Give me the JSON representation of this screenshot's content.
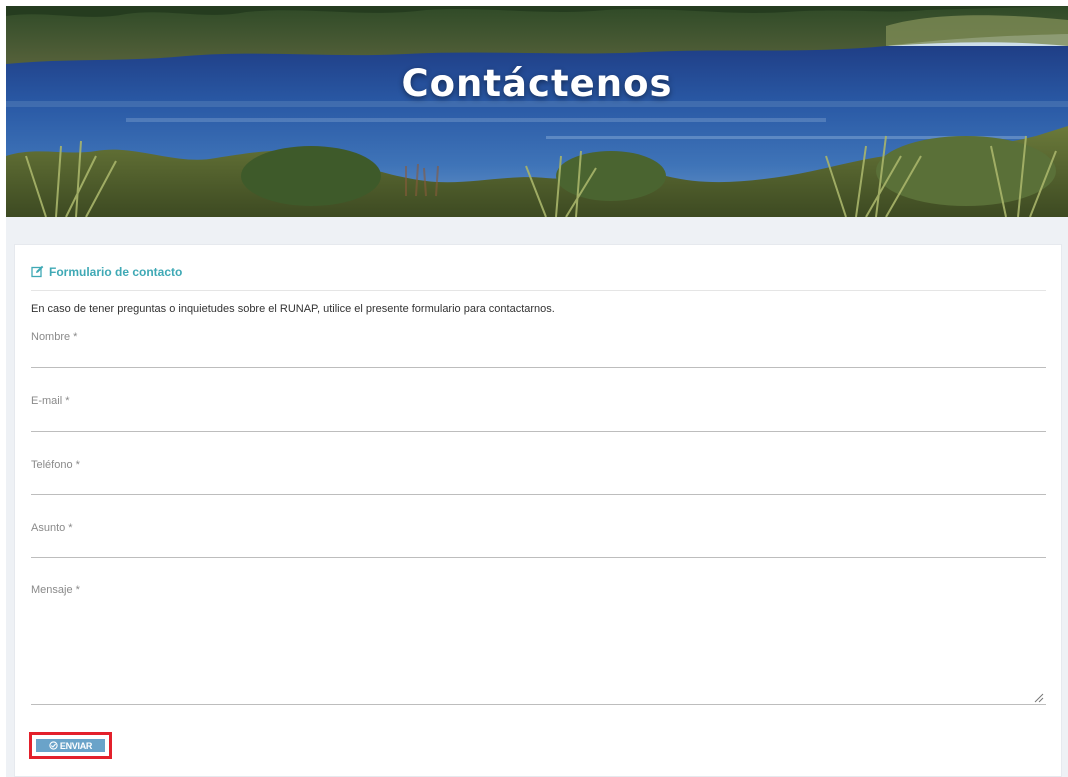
{
  "hero": {
    "title": "Contáctenos"
  },
  "form": {
    "header_title": "Formulario de contacto",
    "header_icon": "edit-icon",
    "intro": "En caso de tener preguntas o inquietudes sobre el RUNAP, utilice el presente formulario para contactarnos.",
    "fields": {
      "nombre": {
        "label": "Nombre *",
        "value": ""
      },
      "email": {
        "label": "E-mail *",
        "value": ""
      },
      "telefono": {
        "label": "Teléfono *",
        "value": ""
      },
      "asunto": {
        "label": "Asunto *",
        "value": ""
      },
      "mensaje": {
        "label": "Mensaje *",
        "value": ""
      }
    },
    "submit": {
      "label": "ENVIAR",
      "icon": "check-circle-icon"
    }
  },
  "colors": {
    "accent": "#3fa9b5",
    "button": "#6aa3c9",
    "highlight_border": "#e3202b"
  }
}
